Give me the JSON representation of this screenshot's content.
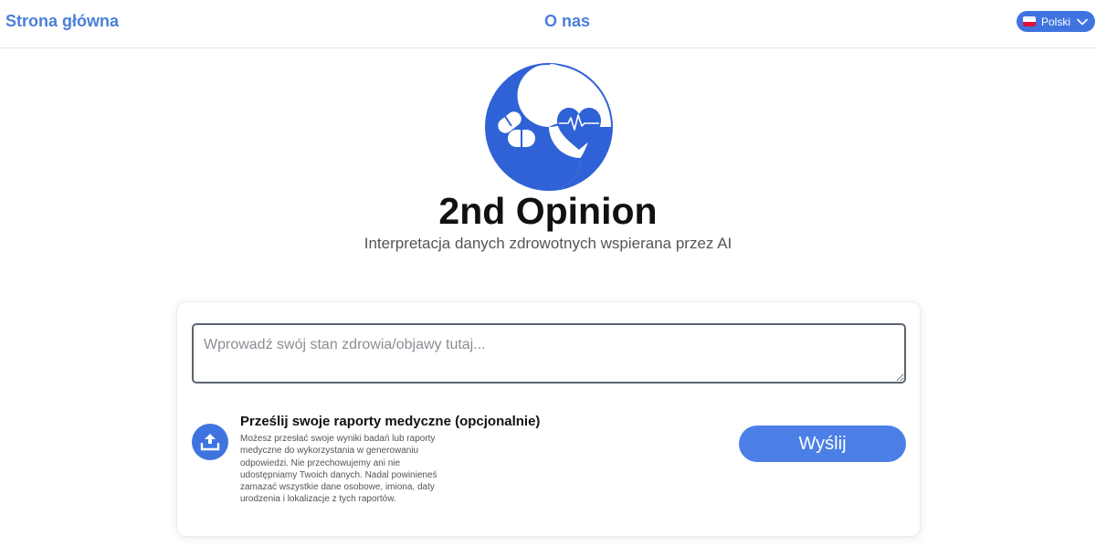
{
  "nav": {
    "home": "Strona główna",
    "about": "O nas",
    "language": "Polski"
  },
  "hero": {
    "title": "2nd Opinion",
    "subtitle": "Interpretacja danych zdrowotnych wspierana przez AI"
  },
  "form": {
    "symptoms_placeholder": "Wprowadź swój stan zdrowia/objawy tutaj...",
    "symptoms_value": "",
    "upload_title": "Prześlij swoje raporty medyczne (opcjonalnie)",
    "upload_description": "Możesz przesłać swoje wyniki badań lub raporty medyczne do wykorzystania w generowaniu odpowiedzi. Nie przechowujemy ani nie udostępniamy Twoich danych. Nadal powinieneś zamazać wszystkie dane osobowe, imiona, daty urodzenia i lokalizacje z tych raportów.",
    "send_label": "Wyślij"
  },
  "icons": {
    "logo": "pills-and-heart-logo",
    "upload": "upload-icon",
    "language_dropdown": "chevron-down-icon",
    "language_flag": "poland-flag-icon"
  },
  "colors": {
    "brand_blue": "#3f74e0",
    "link_blue": "#4a7fd9",
    "send_button": "#4b7fe6"
  }
}
